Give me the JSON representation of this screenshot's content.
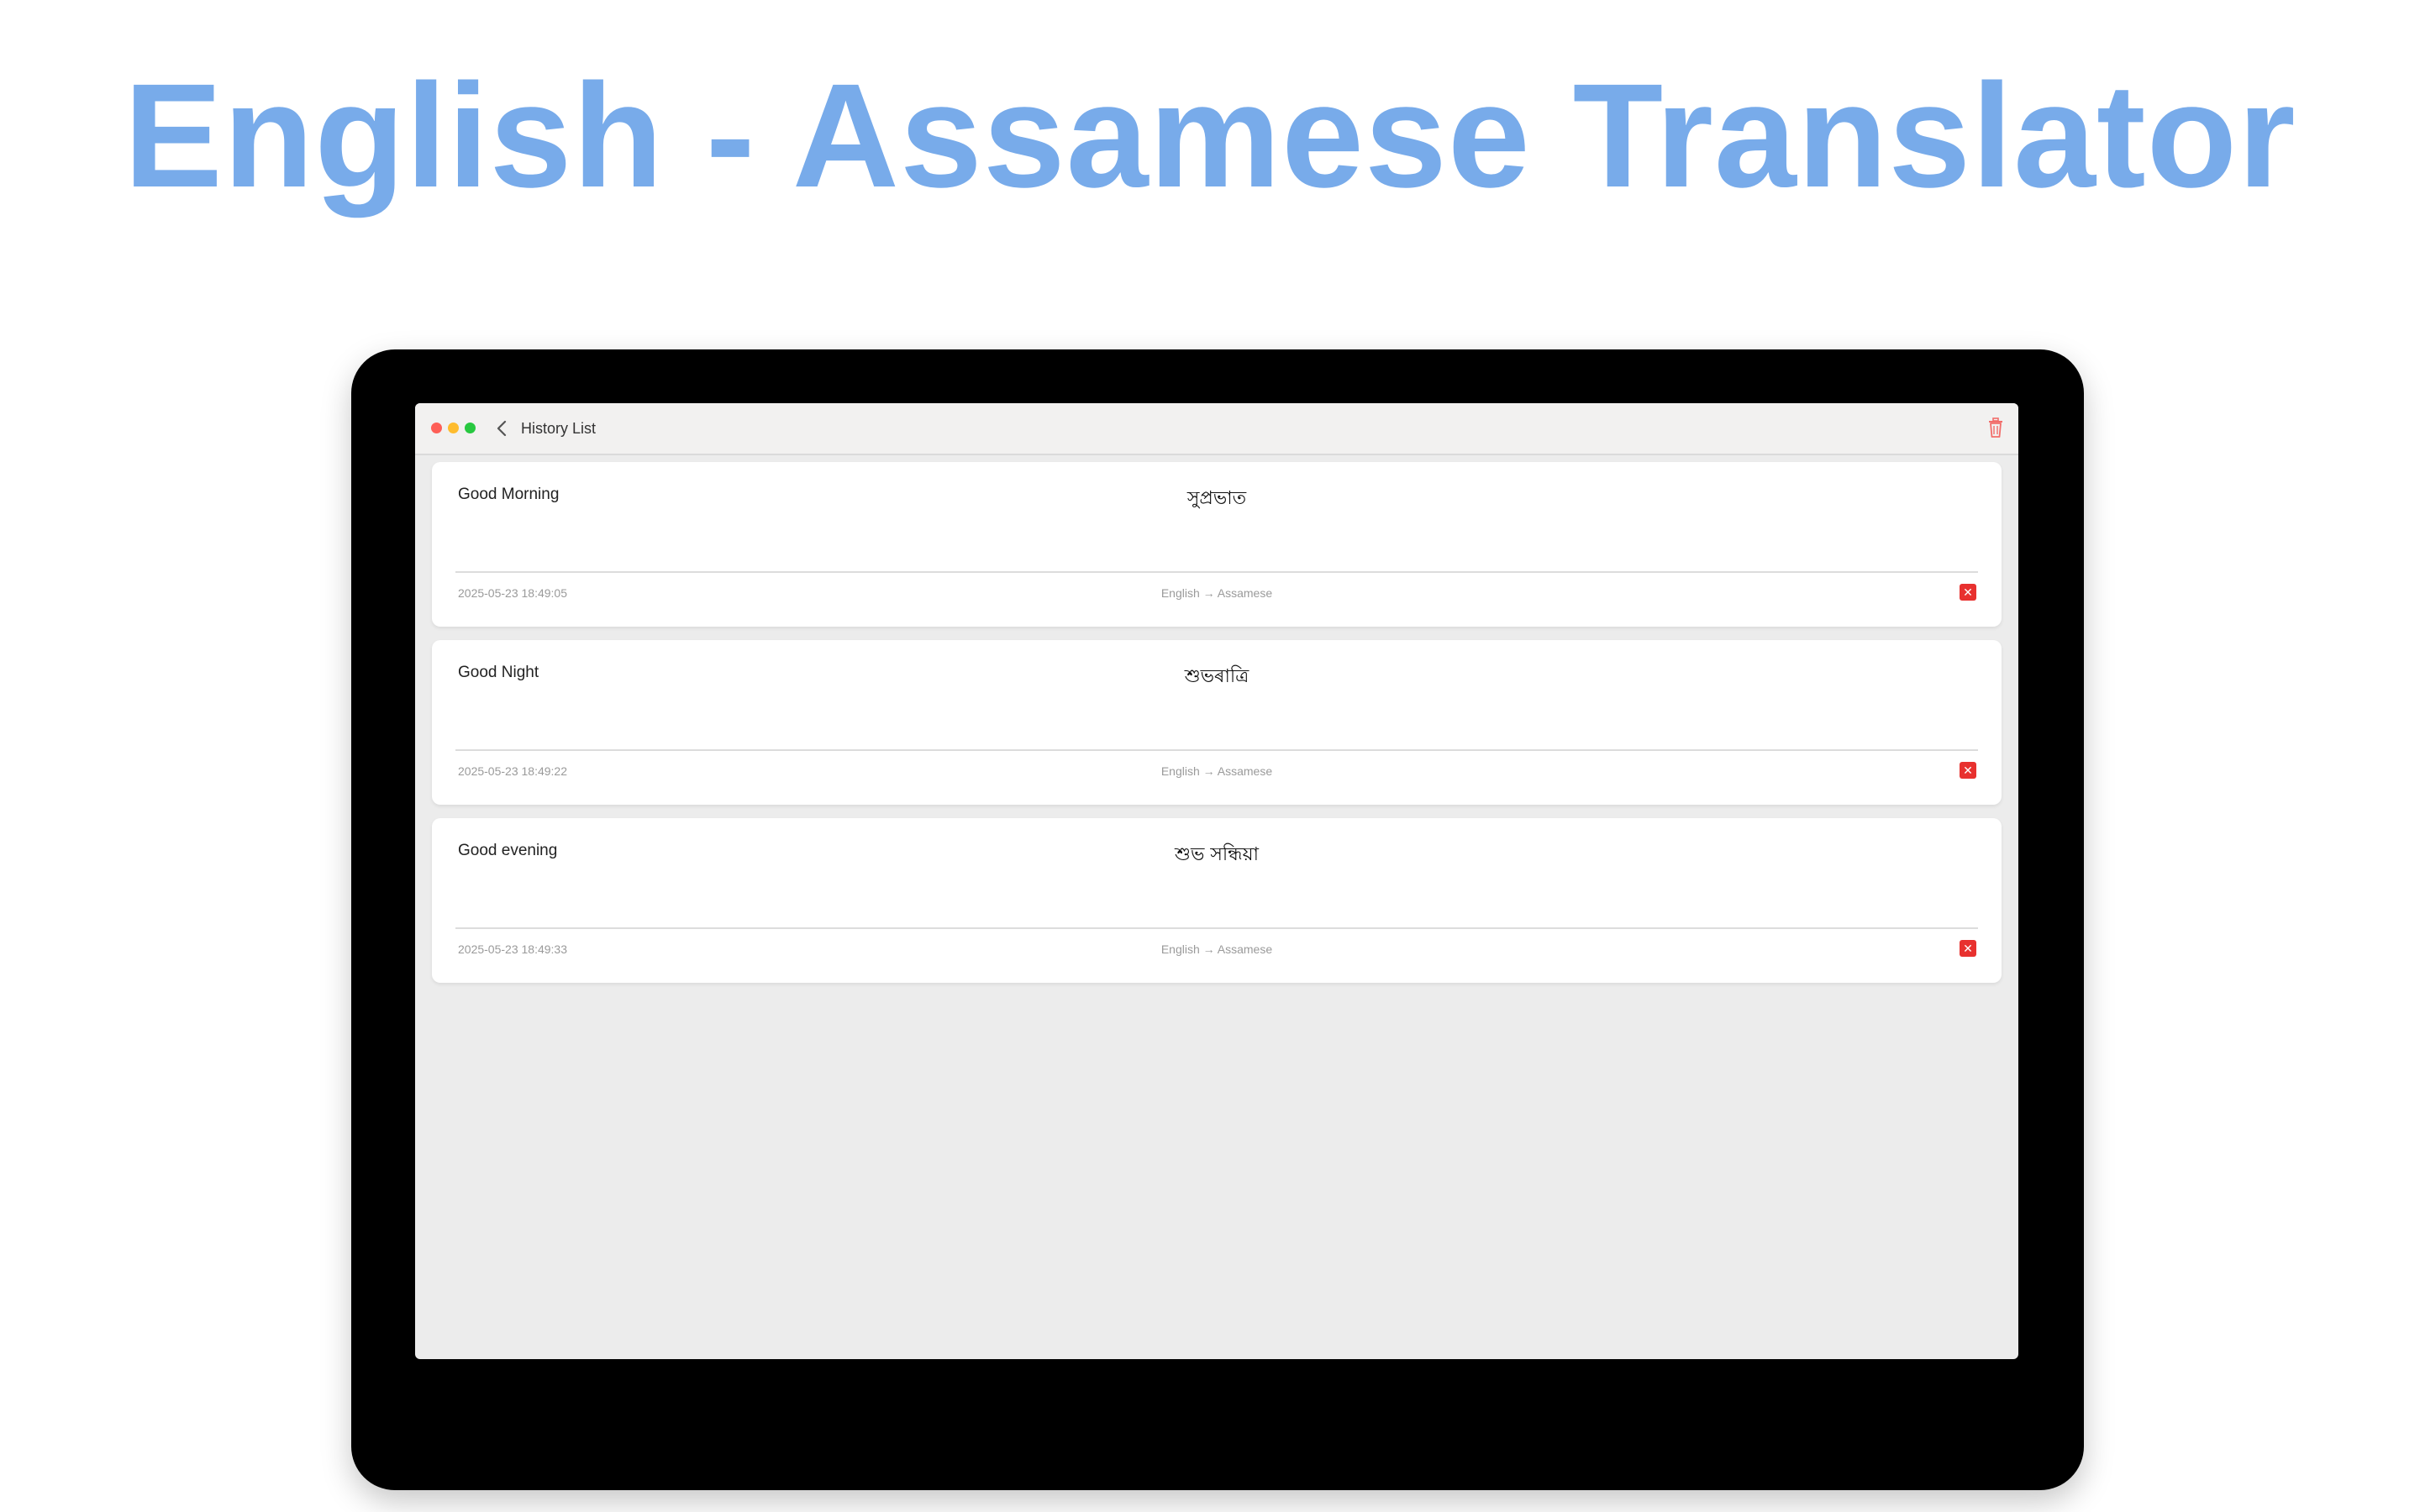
{
  "headline": "English - Assamese Translator",
  "window": {
    "title": "History List",
    "back_icon": "chevron-left-icon",
    "clear_icon": "trash-icon",
    "traffic_lights": {
      "close": "#fe5f57",
      "minimize": "#febc2e",
      "zoom": "#28c840"
    }
  },
  "colors": {
    "headline": "#78abea",
    "delete_button": "#e8312f",
    "trash_icon": "#f26d6a"
  },
  "history": [
    {
      "source": "Good Morning",
      "target": "সুপ্ৰভাত",
      "timestamp": "2025-05-23 18:49:05",
      "direction": "English → Assamese",
      "delete_glyph": "✕"
    },
    {
      "source": "Good Night",
      "target": "শুভৰাত্ৰি",
      "timestamp": "2025-05-23 18:49:22",
      "direction": "English → Assamese",
      "delete_glyph": "✕"
    },
    {
      "source": "Good evening",
      "target": "শুভ সন্ধিয়া",
      "timestamp": "2025-05-23 18:49:33",
      "direction": "English → Assamese",
      "delete_glyph": "✕"
    }
  ]
}
